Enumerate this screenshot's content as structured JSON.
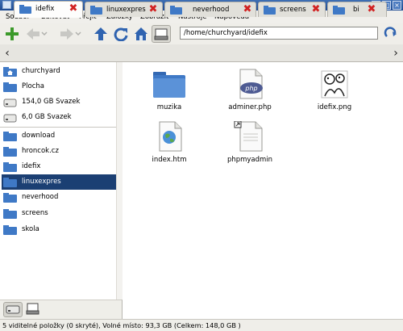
{
  "window": {
    "title": "idefix"
  },
  "menu": [
    "Soubor",
    "Editovat",
    "Přejít",
    "Záložky",
    "Zobrazit",
    "Nástroje",
    "Nápověda"
  ],
  "toolbar": {
    "icons": [
      "new-tab-icon",
      "back-icon",
      "forward-icon",
      "up-icon",
      "reload-icon",
      "home-icon",
      "computer-icon"
    ],
    "location": "/home/churchyard/idefix"
  },
  "tabs": [
    {
      "label": "idefix",
      "active": true
    },
    {
      "label": "linuxexpres",
      "active": false
    },
    {
      "label": "neverhood",
      "active": false
    },
    {
      "label": "screens",
      "active": false
    },
    {
      "label": "bi",
      "active": false
    }
  ],
  "sidebar": {
    "places": [
      {
        "label": "churchyard",
        "icon": "home-folder-icon"
      },
      {
        "label": "Plocha",
        "icon": "desktop-icon"
      },
      {
        "label": "154,0 GB Svazek",
        "icon": "drive-icon"
      },
      {
        "label": "6,0 GB Svazek",
        "icon": "drive-icon"
      }
    ],
    "bookmarks": [
      {
        "label": "download"
      },
      {
        "label": "hroncok.cz"
      },
      {
        "label": "idefix"
      },
      {
        "label": "linuxexpres",
        "selected": true
      },
      {
        "label": "neverhood"
      },
      {
        "label": "screens"
      },
      {
        "label": "skola"
      }
    ]
  },
  "files": [
    {
      "name": "muzika",
      "icon": "folder-icon"
    },
    {
      "name": "adminer.php",
      "icon": "php-file-icon"
    },
    {
      "name": "idefix.png",
      "icon": "image-file-icon"
    },
    {
      "name": "index.htm",
      "icon": "html-file-icon"
    },
    {
      "name": "phpmyadmin",
      "icon": "symlink-file-icon"
    }
  ],
  "status": "5 viditelné položky (0 skryté), Volné místo: 93,3 GB (Celkem: 148,0 GB )",
  "colors": {
    "titlebar": "#2b5aa0",
    "selection": "#1b3f73",
    "folder": "#3f79c6",
    "close": "#d12222"
  }
}
